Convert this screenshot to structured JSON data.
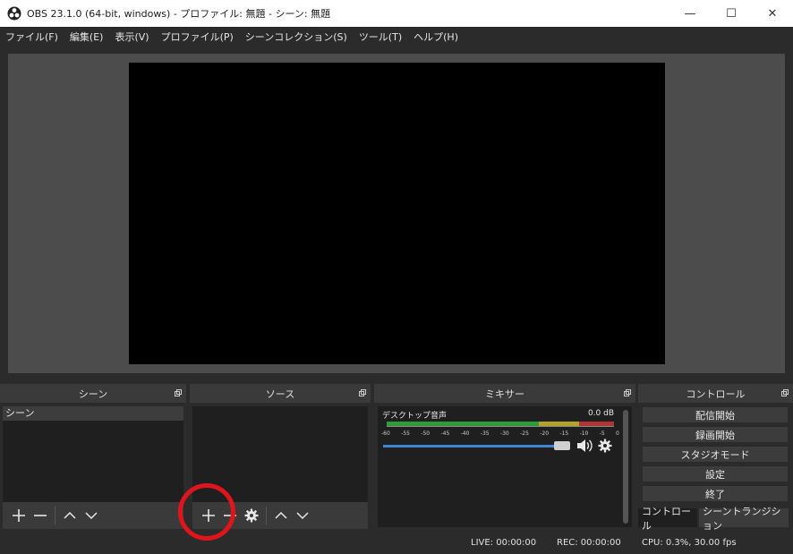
{
  "window": {
    "title": "OBS 23.1.0 (64-bit, windows) - プロファイル: 無題 - シーン: 無題",
    "minimize": "—",
    "maximize": "☐",
    "close": "✕"
  },
  "menu": [
    "ファイル(F)",
    "編集(E)",
    "表示(V)",
    "プロファイル(P)",
    "シーンコレクション(S)",
    "ツール(T)",
    "ヘルプ(H)"
  ],
  "docks": {
    "scene": {
      "title": "シーン",
      "items": [
        "シーン"
      ]
    },
    "source": {
      "title": "ソース"
    },
    "mixer": {
      "title": "ミキサー",
      "track_name": "デスクトップ音声",
      "level": "0.0 dB",
      "tick_labels": [
        "-60",
        "-55",
        "-50",
        "-45",
        "-40",
        "-35",
        "-30",
        "-25",
        "-20",
        "-15",
        "-10",
        "-5",
        "0"
      ],
      "volume_fraction": 0.95
    },
    "control": {
      "title": "コントロール",
      "buttons": [
        "配信開始",
        "録画開始",
        "スタジオモード",
        "設定",
        "終了"
      ],
      "tabs": [
        "コントロール",
        "シーントランジション"
      ]
    }
  },
  "status": {
    "live": "LIVE: 00:00:00",
    "rec": "REC: 00:00:00",
    "cpu": "CPU: 0.3%, 30.00 fps"
  },
  "colors": {
    "annotation": "#e0151b",
    "accent": "#3d86d6"
  }
}
